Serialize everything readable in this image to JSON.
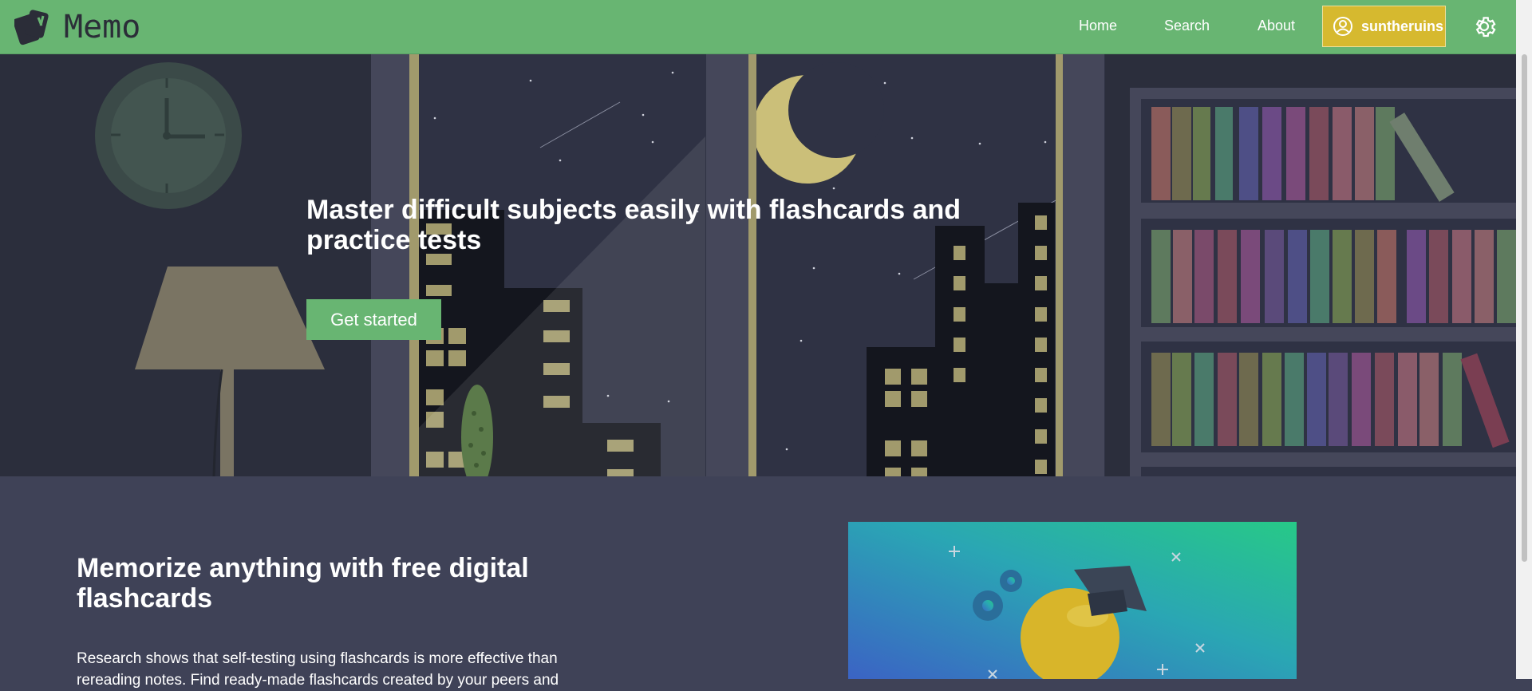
{
  "app": {
    "name": "Memo"
  },
  "nav": {
    "links": [
      "Home",
      "Search",
      "About"
    ],
    "username": "suntheruins"
  },
  "hero": {
    "title": "Master difficult subjects easily with flashcards and practice tests",
    "cta_label": "Get started"
  },
  "features": {
    "title": "Memorize anything with free digital flashcards",
    "body": "Research shows that self-testing using flashcards is more effective than rereading notes. Find ready-made flashcards created by your peers and"
  },
  "colors": {
    "navbar": "#68b572",
    "accent_green": "#68b572",
    "user_button": "#d6b92f",
    "section_bg": "#3f4257",
    "hero_bg": "#2b2e3c"
  },
  "icons": [
    "logo-cards-icon",
    "user-circle-icon",
    "gear-icon"
  ]
}
